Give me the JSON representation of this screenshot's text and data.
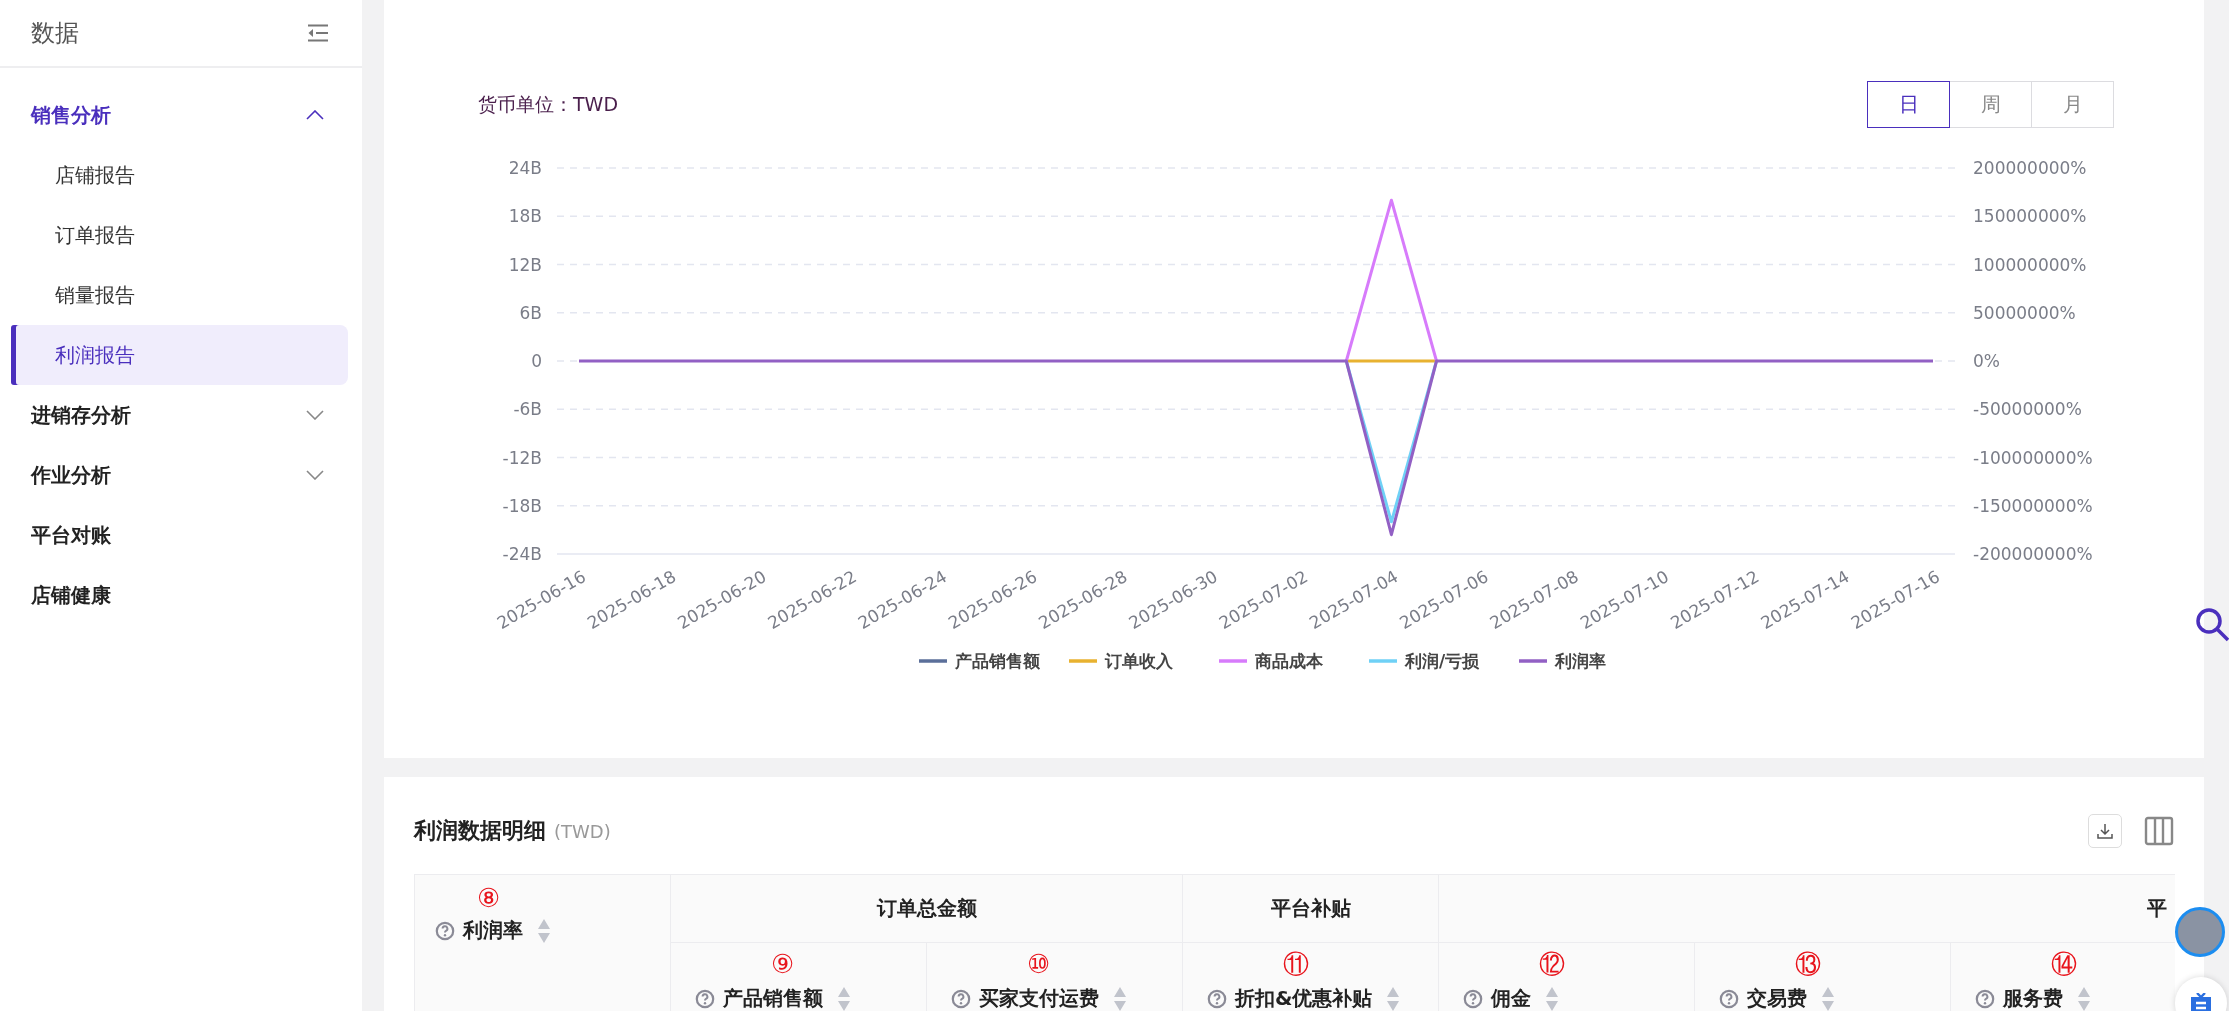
{
  "sidebar": {
    "title": "数据",
    "items": [
      {
        "label": "销售分析",
        "kind": "group",
        "expanded": true,
        "selected": true,
        "children": [
          {
            "label": "店铺报告",
            "selected": false
          },
          {
            "label": "订单报告",
            "selected": false
          },
          {
            "label": "销量报告",
            "selected": false
          },
          {
            "label": "利润报告",
            "selected": true
          }
        ]
      },
      {
        "label": "进销存分析",
        "kind": "group",
        "expanded": false,
        "selected": false
      },
      {
        "label": "作业分析",
        "kind": "group",
        "expanded": false,
        "selected": false
      },
      {
        "label": "平台对账",
        "kind": "link",
        "selected": false
      },
      {
        "label": "店铺健康",
        "kind": "link",
        "selected": false
      }
    ]
  },
  "chart_panel": {
    "currency_label": "货币单位：TWD",
    "periods": [
      {
        "label": "日",
        "selected": true
      },
      {
        "label": "周",
        "selected": false
      },
      {
        "label": "月",
        "selected": false
      }
    ],
    "chart_data": {
      "type": "line",
      "categories": [
        "2025-06-16",
        null,
        "2025-06-18",
        null,
        "2025-06-20",
        null,
        "2025-06-22",
        null,
        "2025-06-24",
        null,
        "2025-06-26",
        null,
        "2025-06-28",
        null,
        "2025-06-30",
        null,
        "2025-07-02",
        null,
        "2025-07-04",
        null,
        "2025-07-06",
        null,
        "2025-07-08",
        null,
        "2025-07-10",
        null,
        "2025-07-12",
        null,
        "2025-07-14",
        null,
        "2025-07-16"
      ],
      "grid": true,
      "legend": "bottom",
      "ylim": [
        -24000000000,
        24000000000
      ],
      "yticks": [
        {
          "value": 24000000000,
          "label": "24B"
        },
        {
          "value": 18000000000,
          "label": "18B"
        },
        {
          "value": 12000000000,
          "label": "12B"
        },
        {
          "value": 6000000000,
          "label": "6B"
        },
        {
          "value": 0,
          "label": "0"
        },
        {
          "value": -6000000000,
          "label": "-6B"
        },
        {
          "value": -12000000000,
          "label": "-12B"
        },
        {
          "value": -18000000000,
          "label": "-18B"
        },
        {
          "value": -24000000000,
          "label": "-24B"
        }
      ],
      "y2lim": [
        -200000000,
        200000000
      ],
      "y2ticks": [
        {
          "value": 200000000,
          "label": "200000000%"
        },
        {
          "value": 150000000,
          "label": "150000000%"
        },
        {
          "value": 100000000,
          "label": "100000000%"
        },
        {
          "value": 50000000,
          "label": "50000000%"
        },
        {
          "value": 0,
          "label": "0%"
        },
        {
          "value": -50000000,
          "label": "-50000000%"
        },
        {
          "value": -100000000,
          "label": "-100000000%"
        },
        {
          "value": -150000000,
          "label": "-150000000%"
        },
        {
          "value": -200000000,
          "label": "-200000000%"
        }
      ],
      "series": [
        {
          "name": "产品销售额",
          "color": "#5b6f9a",
          "values": [
            null,
            null,
            null,
            null,
            null,
            null,
            null,
            null,
            null,
            null,
            null,
            null,
            null,
            null,
            null,
            null,
            null,
            null,
            null,
            null,
            null,
            null,
            null,
            null,
            null,
            null,
            null,
            null,
            null,
            null,
            null
          ]
        },
        {
          "name": "订单收入",
          "color": "#e8b230",
          "values": [
            null,
            null,
            null,
            null,
            null,
            null,
            null,
            null,
            null,
            null,
            null,
            null,
            null,
            null,
            null,
            null,
            null,
            0,
            0,
            0,
            null,
            null,
            null,
            null,
            null,
            null,
            null,
            null,
            null,
            null,
            null
          ]
        },
        {
          "name": "商品成本",
          "color": "#d77bfb",
          "values": [
            null,
            null,
            null,
            null,
            null,
            null,
            null,
            null,
            null,
            null,
            null,
            null,
            null,
            null,
            null,
            null,
            null,
            0,
            20000000000,
            0,
            null,
            null,
            null,
            null,
            null,
            null,
            null,
            null,
            null,
            null,
            null
          ]
        },
        {
          "name": "利润/亏损",
          "color": "#6fd1f6",
          "values": [
            null,
            null,
            null,
            null,
            null,
            null,
            null,
            null,
            null,
            null,
            null,
            null,
            null,
            null,
            null,
            null,
            null,
            0,
            -20000000000,
            0,
            null,
            null,
            null,
            null,
            null,
            null,
            null,
            null,
            null,
            null,
            null
          ]
        },
        {
          "name": "利润率",
          "color": "#9260c4",
          "axis": "y2",
          "values": [
            0,
            0,
            0,
            0,
            0,
            0,
            0,
            0,
            0,
            0,
            0,
            0,
            0,
            0,
            0,
            0,
            0,
            0,
            -180000000,
            0,
            0,
            0,
            0,
            0,
            0,
            0,
            0,
            0,
            0,
            0,
            0
          ]
        }
      ]
    }
  },
  "table_panel": {
    "title": "利润数据明细",
    "unit": "(TWD)",
    "first_column": {
      "marker": "⑧",
      "label": "利润率"
    },
    "groups": [
      {
        "label": "订单总金额",
        "columns": [
          {
            "marker": "⑨",
            "label": "产品销售额"
          },
          {
            "marker": "⑩",
            "label": "买家支付运费"
          }
        ]
      },
      {
        "label": "平台补贴",
        "columns": [
          {
            "marker": "⑪",
            "label": "折扣&优惠补贴"
          }
        ]
      },
      {
        "label": "平",
        "columns": [
          {
            "marker": "⑫",
            "label": "佣金"
          },
          {
            "marker": "⑬",
            "label": "交易费"
          },
          {
            "marker": "⑭",
            "label": "服务费"
          }
        ]
      }
    ]
  }
}
